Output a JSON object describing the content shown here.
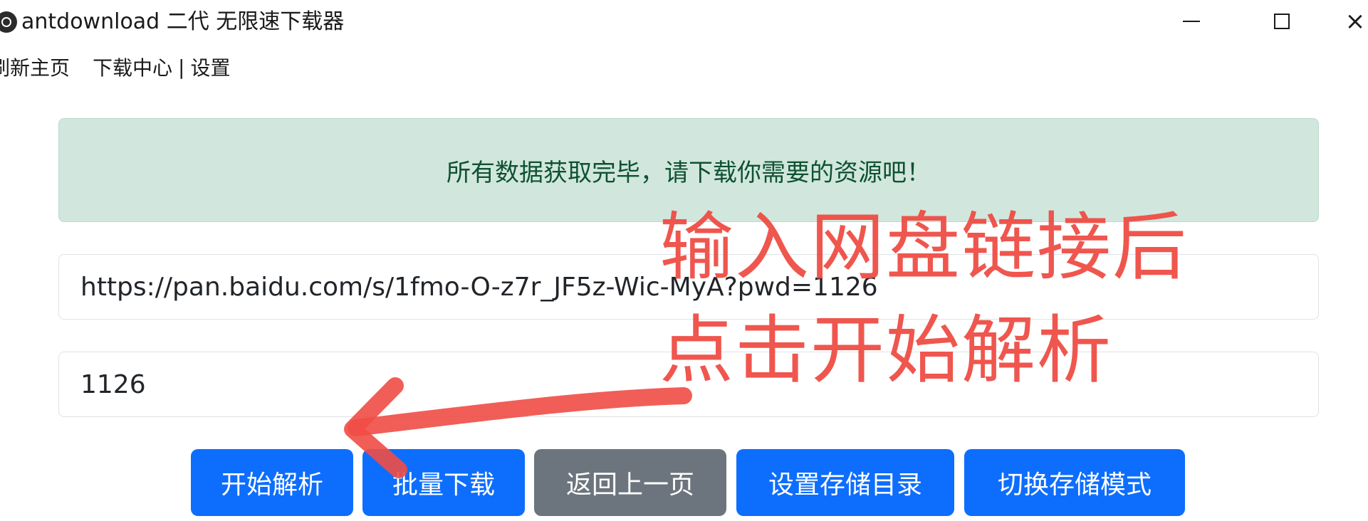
{
  "window": {
    "title": "antdownload 二代 无限速下载器",
    "controls": {
      "minimize": "minimize-icon",
      "maximize": "maximize-icon",
      "close_glyph": "×"
    }
  },
  "menu": {
    "refresh_home": "刷新主页",
    "download_center": "下载中心",
    "separator": "|",
    "settings": "设置"
  },
  "alert": {
    "message": "所有数据获取完毕，请下载你需要的资源吧！",
    "colors": {
      "background": "#d1e7dd",
      "text": "#0f5132"
    }
  },
  "form": {
    "link_value": "https://pan.baidu.com/s/1fmo-O-z7r_JF5z-Wic-MyA?pwd=1126",
    "password_value": "1126"
  },
  "buttons": {
    "start_parse": "开始解析",
    "batch_download": "批量下载",
    "go_back": "返回上一页",
    "set_storage_dir": "设置存储目录",
    "switch_storage_mode": "切换存储模式"
  },
  "annotation": {
    "line1": "输入网盘链接后",
    "line2": "点击开始解析",
    "color": "#ef4d45"
  },
  "colors": {
    "primary": "#0d6efd",
    "secondary": "#6c757d"
  }
}
